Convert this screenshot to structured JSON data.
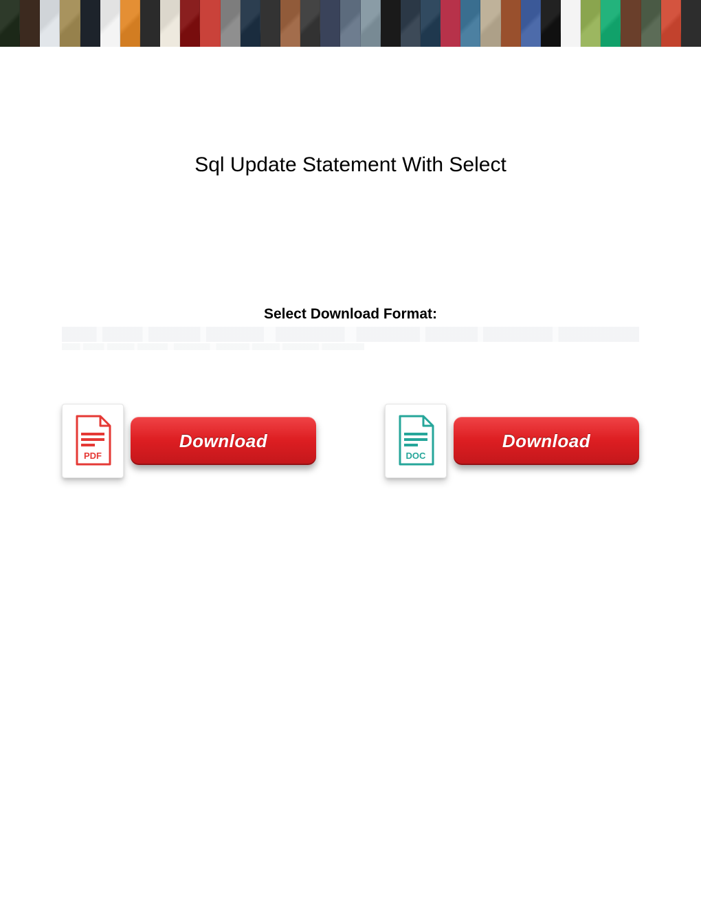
{
  "title": "Sql Update Statement With Select",
  "format_label": "Select Download Format:",
  "buttons": {
    "pdf": {
      "icon_label": "PDF",
      "button_text": "Download"
    },
    "doc": {
      "icon_label": "DOC",
      "button_text": "Download"
    }
  },
  "colors": {
    "pdf_accent": "#e53935",
    "doc_accent": "#26a69a",
    "button_red_top": "#f04346",
    "button_red_bottom": "#c3171b"
  },
  "banner_thumbs": [
    "#2e3a2a",
    "#3c2a1f",
    "#d0d4d8",
    "#a8935e",
    "#1d232b",
    "#e2e2e2",
    "#e48f34",
    "#2b2b2b",
    "#dcd7cc",
    "#8a1f1f",
    "#c9423a",
    "#7d7d7d",
    "#2c3e50",
    "#333333",
    "#915b3a",
    "#444",
    "#3a435a",
    "#5c6b7d",
    "#8a9ca6",
    "#1a1a1a",
    "#2b3846",
    "#314a60",
    "#b7324a",
    "#3a6e8f",
    "#bfb29a",
    "#99502d",
    "#3b5998",
    "#222",
    "#f4f4f4",
    "#8aa54e",
    "#23b37c",
    "#6a3f2b",
    "#4a5a45",
    "#d4543f",
    "#2d2d2d"
  ]
}
